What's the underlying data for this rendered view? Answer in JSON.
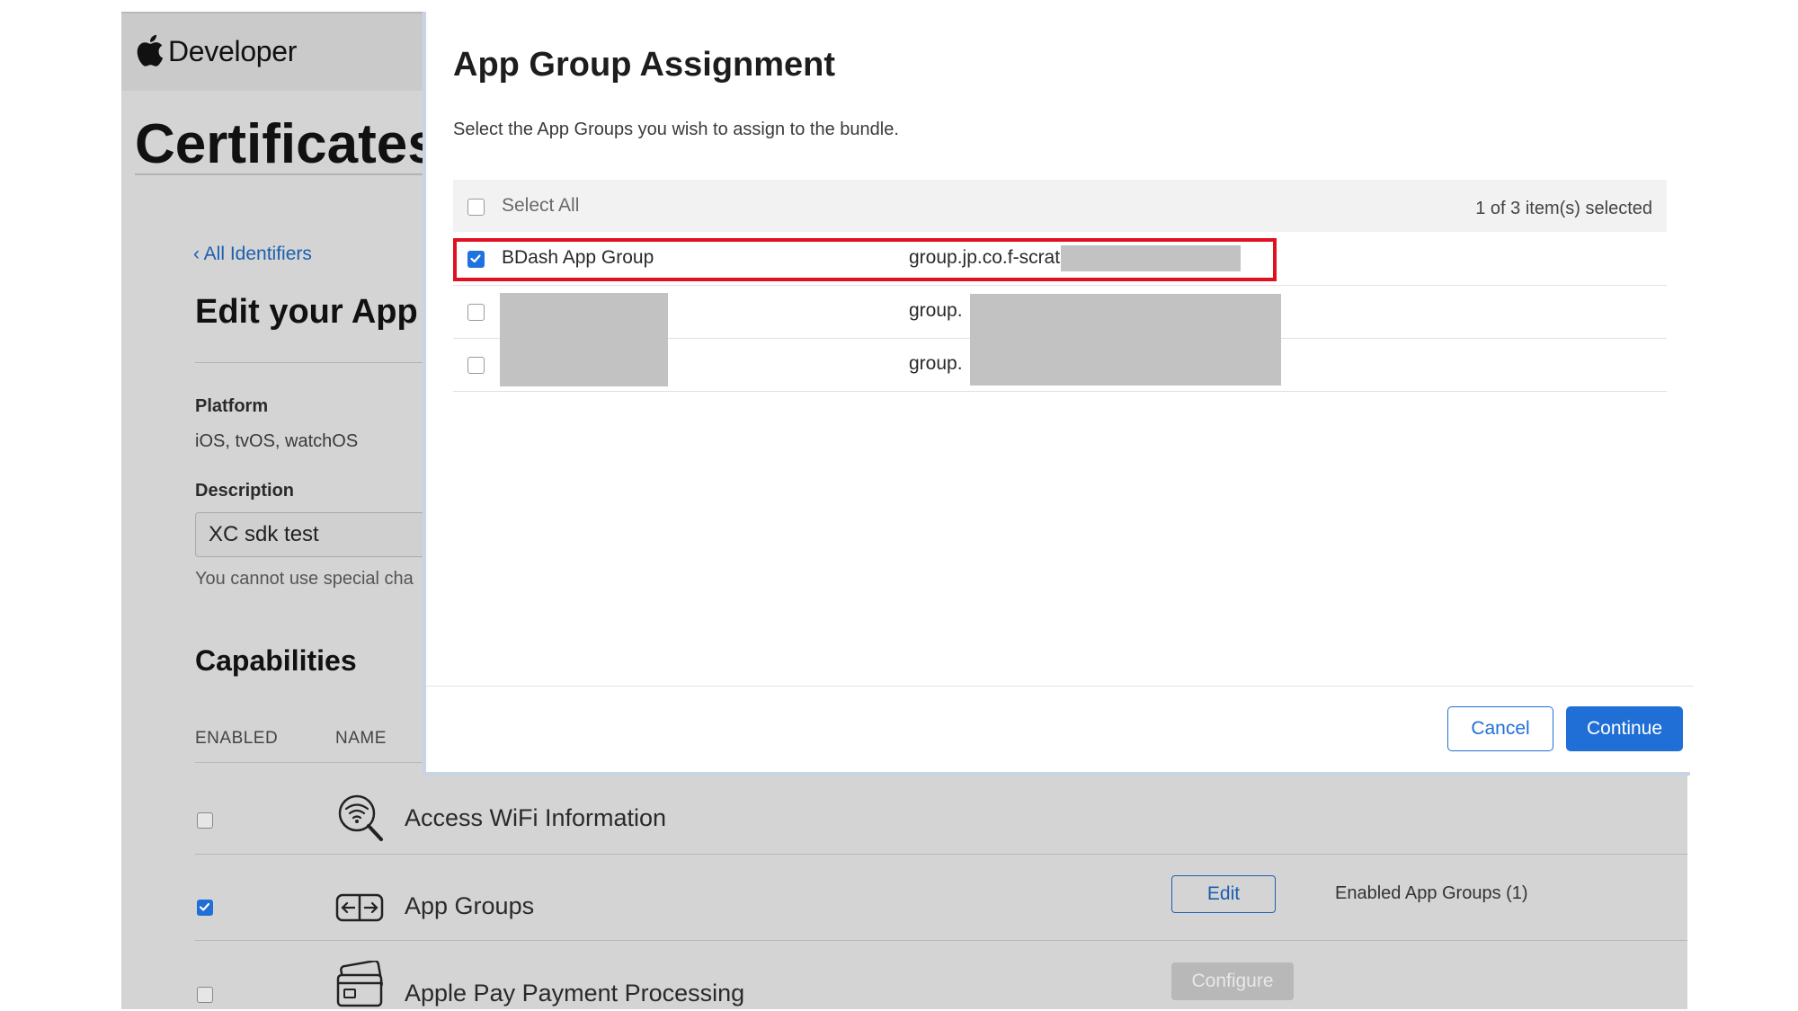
{
  "background_page": {
    "brand": "Developer",
    "page_title": "Certificates",
    "back_link": "‹ All Identifiers",
    "section_title": "Edit your App",
    "platform": {
      "label": "Platform",
      "value": "iOS, tvOS, watchOS"
    },
    "description": {
      "label": "Description",
      "value": "XC sdk test",
      "help": "You cannot use special cha"
    },
    "capabilities": {
      "title": "Capabilities",
      "col_enabled": "ENABLED",
      "col_name": "NAME",
      "items": [
        {
          "name": "Access WiFi Information",
          "enabled": false,
          "icon": "wifi-search-icon"
        },
        {
          "name": "App Groups",
          "enabled": true,
          "icon": "app-groups-icon",
          "action": "Edit",
          "status": "Enabled App Groups (1)"
        },
        {
          "name": "Apple Pay Payment Processing",
          "enabled": false,
          "icon": "credit-card-icon",
          "action": "Configure"
        }
      ]
    }
  },
  "modal": {
    "title": "App Group Assignment",
    "subtitle": "Select the App Groups you wish to assign to the bundle.",
    "select_all": "Select All",
    "selected_count": "1 of 3 item(s) selected",
    "rows": [
      {
        "name": "BDash App Group",
        "identifier": "group.jp.co.f-scratch.",
        "checked": true
      },
      {
        "name": "",
        "identifier": "group.",
        "checked": false
      },
      {
        "name": "",
        "identifier": "group.",
        "checked": false
      }
    ],
    "cancel": "Cancel",
    "continue": "Continue"
  },
  "colors": {
    "accent": "#1f6fd6",
    "highlight": "#e01020",
    "link": "#1c5fb0"
  }
}
